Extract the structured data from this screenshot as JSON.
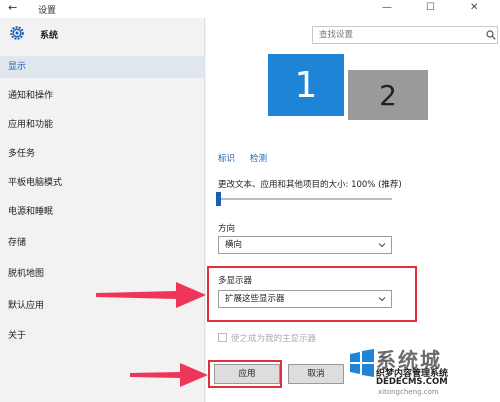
{
  "window": {
    "back_glyph": "←",
    "title": "设置",
    "minimize": "—",
    "maximize": "☐",
    "close": "✕"
  },
  "sidebar": {
    "header_label": "系统",
    "items": [
      {
        "label": "显示",
        "active": true
      },
      {
        "label": "通知和操作"
      },
      {
        "label": "应用和功能"
      },
      {
        "label": "多任务"
      },
      {
        "label": "平板电脑模式"
      },
      {
        "label": "电源和睡眠"
      },
      {
        "label": "存储"
      },
      {
        "label": "脱机地图"
      },
      {
        "label": "默认应用"
      },
      {
        "label": "关于"
      }
    ]
  },
  "search": {
    "placeholder": "查找设置"
  },
  "monitors": {
    "primary": "1",
    "secondary": "2"
  },
  "links": {
    "identify": "标识",
    "detect": "检测"
  },
  "scale": {
    "label": "更改文本、应用和其他项目的大小: 100% (推荐)",
    "value": 100
  },
  "orientation": {
    "label": "方向",
    "value": "横向"
  },
  "multi_display": {
    "label": "多显示器",
    "value": "扩展这些显示器"
  },
  "main_display_checkbox": {
    "label": "使之成为我的主显示器",
    "checked": false
  },
  "buttons": {
    "apply": "应用",
    "cancel": "取消"
  },
  "watermark": {
    "line1": "系统城",
    "line2": "织梦内容管理系统",
    "line3": "DEDECMS.COM",
    "line4": "xitongcheng.com"
  },
  "colors": {
    "accent": "#1e84d8",
    "highlight_red": "#e0303a",
    "arrow_pink": "#f0355a"
  }
}
